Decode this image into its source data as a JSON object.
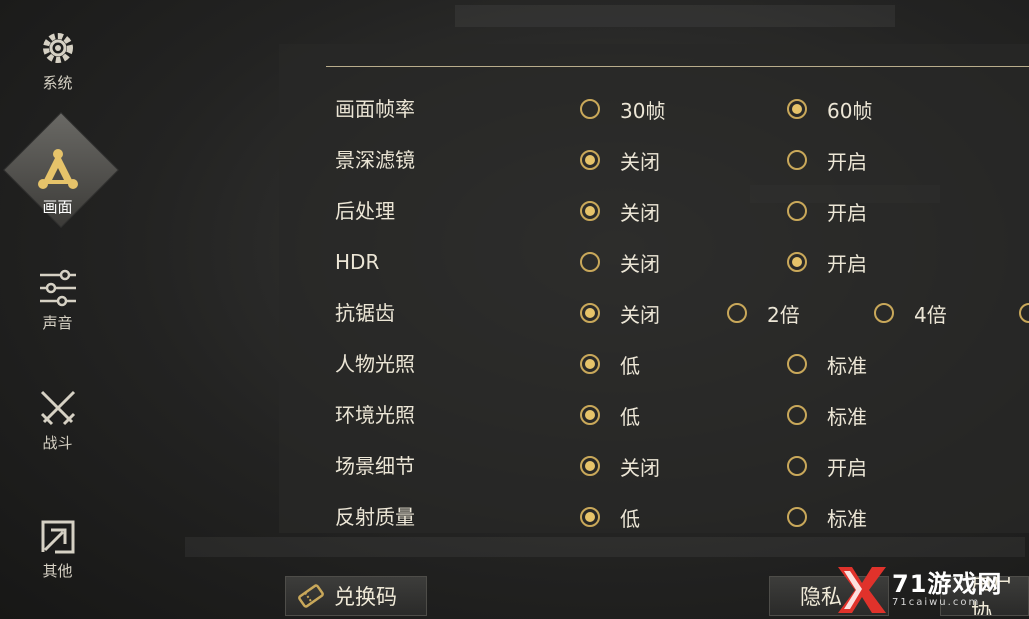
{
  "sidebar": {
    "items": [
      {
        "label": "系统",
        "icon": "gear-icon"
      },
      {
        "label": "画面",
        "icon": "triangle-nodes-icon"
      },
      {
        "label": "声音",
        "icon": "sliders-icon"
      },
      {
        "label": "战斗",
        "icon": "crossed-swords-icon"
      },
      {
        "label": "其他",
        "icon": "arrow-box-icon"
      }
    ],
    "active": "画面"
  },
  "settings": [
    {
      "label": "画面帧率",
      "options": [
        {
          "label": "30帧",
          "selected": false
        },
        {
          "label": "60帧",
          "selected": true
        }
      ]
    },
    {
      "label": "景深滤镜",
      "options": [
        {
          "label": "关闭",
          "selected": true
        },
        {
          "label": "开启",
          "selected": false
        }
      ]
    },
    {
      "label": "后处理",
      "options": [
        {
          "label": "关闭",
          "selected": true
        },
        {
          "label": "开启",
          "selected": false
        }
      ]
    },
    {
      "label": "HDR",
      "options": [
        {
          "label": "关闭",
          "selected": false
        },
        {
          "label": "开启",
          "selected": true
        }
      ]
    },
    {
      "label": "抗锯齿",
      "options": [
        {
          "label": "关闭",
          "selected": true
        },
        {
          "label": "2倍",
          "selected": false
        },
        {
          "label": "4倍",
          "selected": false
        }
      ]
    },
    {
      "label": "人物光照",
      "options": [
        {
          "label": "低",
          "selected": true
        },
        {
          "label": "标准",
          "selected": false
        }
      ]
    },
    {
      "label": "环境光照",
      "options": [
        {
          "label": "低",
          "selected": true
        },
        {
          "label": "标准",
          "selected": false
        }
      ]
    },
    {
      "label": "场景细节",
      "options": [
        {
          "label": "关闭",
          "selected": true
        },
        {
          "label": "开启",
          "selected": false
        }
      ]
    },
    {
      "label": "反射质量",
      "options": [
        {
          "label": "低",
          "selected": true
        },
        {
          "label": "标准",
          "selected": false
        }
      ]
    }
  ],
  "bottom": {
    "redeem_label": "兑换码",
    "privacy_label": "隐私",
    "user_label": "用户协"
  },
  "watermark": {
    "text": "71游戏网",
    "sub": "71caiwu.com"
  },
  "colors": {
    "accent": "#e6c36a",
    "ring": "#c9a85a",
    "logo_red": "#e0322b"
  }
}
